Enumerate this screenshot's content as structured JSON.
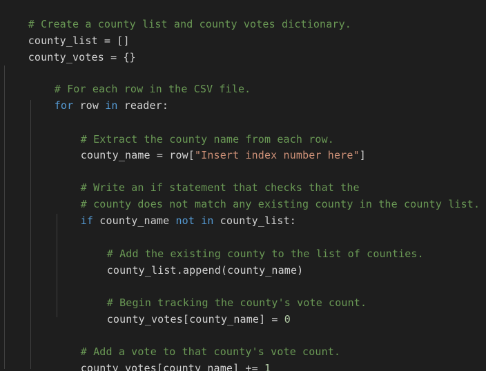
{
  "code": {
    "l1": {
      "comment": "# Create a county list and county votes dictionary."
    },
    "l2": {
      "a": "county_list = []"
    },
    "l3": {
      "a": "county_votes = {}"
    },
    "l4": {
      "comment": "# For each row in the CSV file."
    },
    "l5": {
      "kw1": "for",
      "a": " row ",
      "kw2": "in",
      "b": " reader:"
    },
    "l6": {
      "comment": "# Extract the county name from each row."
    },
    "l7": {
      "a": "county_name = row[",
      "str": "\"Insert index number here\"",
      "b": "]"
    },
    "l8": {
      "comment": "# Write an if statement that checks that the"
    },
    "l9": {
      "comment": "# county does not match any existing county in the county list."
    },
    "l10": {
      "kw1": "if",
      "a": " county_name ",
      "kw2": "not",
      "b": " ",
      "kw3": "in",
      "c": " county_list:"
    },
    "l11": {
      "comment": "# Add the existing county to the list of counties."
    },
    "l12": {
      "a": "county_list.append(county_name)"
    },
    "l13": {
      "comment": "# Begin tracking the county's vote count."
    },
    "l14": {
      "a": "county_votes[county_name] = ",
      "num": "0"
    },
    "l15": {
      "comment": "# Add a vote to that county's vote count."
    },
    "l16": {
      "a": "county_votes[county_name] += ",
      "num": "1"
    }
  },
  "colors": {
    "background": "#1e1e1e",
    "comment": "#6a9955",
    "keyword": "#569cd6",
    "string": "#ce9178",
    "number": "#b5cea8",
    "text": "#d4d4d4"
  }
}
